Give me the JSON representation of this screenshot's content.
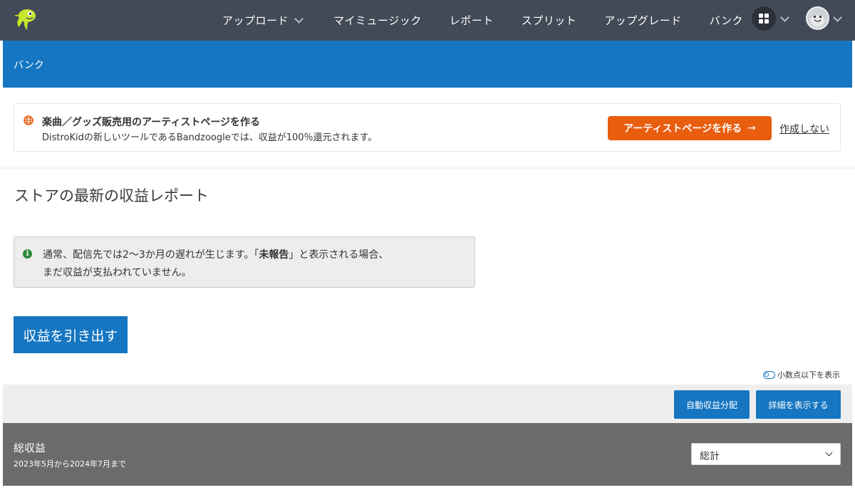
{
  "nav": {
    "upload": "アップロード",
    "my_music": "マイミュージック",
    "reports": "レポート",
    "splits": "スプリット",
    "upgrade": "アップグレード",
    "bank": "バンク"
  },
  "header": {
    "title": "バンク"
  },
  "promo": {
    "title": "楽曲／グッズ販売用のアーティストページを作る",
    "description": "DistroKidの新しいツールであるBandzoogleでは、収益が100％還元されます。",
    "cta_label": "アーティストページを作る",
    "cta_arrow": "→",
    "dismiss_label": "作成しない",
    "accent_color": "#e95d0f"
  },
  "main": {
    "heading": "ストアの最新の収益レポート",
    "notice": {
      "line1_prefix": "通常、配信先では2〜3か月の遅れが生じます。「",
      "line1_bold": "未報告",
      "line1_suffix": "」と表示される場合、",
      "line2": "まだ収益が支払われていません。"
    },
    "withdraw_label": "収益を引き出す",
    "decimal_toggle_label": "小数点以下を表示",
    "auto_split_label": "自動収益分配",
    "details_label": "詳細を表示する"
  },
  "totals": {
    "title": "総収益",
    "range": "2023年5月から2024年7月まで",
    "select_value": "総計"
  },
  "colors": {
    "nav_bg": "#424a57",
    "brand_blue": "#1676c1",
    "totals_bg": "#6b6b6b"
  }
}
